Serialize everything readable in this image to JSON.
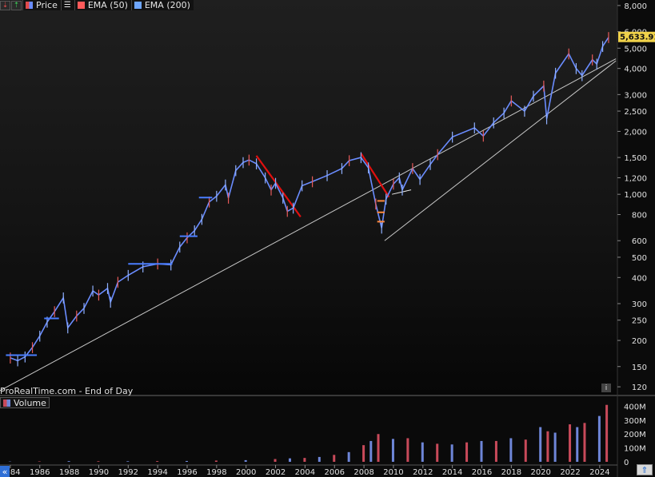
{
  "legend": {
    "items": [
      {
        "label": "Price",
        "color": "#6a8cff"
      },
      {
        "label": "EMA (50)",
        "color": "#ff5a5a"
      },
      {
        "label": "EMA (200)",
        "color": "#6ea6ff"
      }
    ]
  },
  "watermark": "ProRealTime.com - End of Day",
  "volume_label": "Volume",
  "info_icon": "i",
  "chart_data": [
    {
      "type": "line",
      "scale": "log",
      "y_ticks": [
        120,
        150,
        200,
        250,
        300,
        400,
        500,
        600,
        800,
        1000,
        1200,
        1500,
        2000,
        2500,
        3000,
        4000,
        5000,
        6000,
        8000
      ],
      "y_tick_labels": [
        "120",
        "150",
        "200",
        "250",
        "300",
        "400",
        "500",
        "600",
        "800",
        "1,000",
        "1,200",
        "1,500",
        "2,000",
        "2,500",
        "3,000",
        "4,000",
        "5,000",
        "6,000",
        "8,000"
      ],
      "ylim": [
        110,
        8500
      ],
      "xlim": [
        1983.3,
        2025.2
      ],
      "last_price": 5633.91,
      "last_price_label": "5,633.91",
      "series": [
        {
          "x": [
            1984.0,
            1984.5,
            1985.0,
            1985.5,
            1986.0,
            1986.5,
            1987.0,
            1987.6,
            1987.9,
            1988.5,
            1989.0,
            1989.6,
            1990.0,
            1990.6,
            1990.8,
            1991.3,
            1992.0,
            1993.0,
            1994.0,
            1994.9,
            1995.5,
            1996.0,
            1996.5,
            1997.0,
            1997.5,
            1998.0,
            1998.6,
            1998.8,
            1999.3,
            1999.8,
            2000.2,
            2000.7,
            2001.3,
            2001.7,
            2002.0,
            2002.5,
            2002.8,
            2003.2,
            2003.8,
            2004.5,
            2005.5,
            2006.5,
            2007.0,
            2007.8,
            2008.3,
            2008.8,
            2009.2,
            2009.5,
            2010.0,
            2010.4,
            2010.6,
            2011.3,
            2011.8,
            2012.5,
            2013.0,
            2014.0,
            2015.5,
            2016.1,
            2016.8,
            2017.5,
            2018.0,
            2018.9,
            2019.5,
            2020.2,
            2020.4,
            2021.0,
            2021.9,
            2022.4,
            2022.8,
            2023.5,
            2023.8,
            2024.2,
            2024.6
          ],
          "values": [
            165,
            160,
            167,
            185,
            210,
            245,
            275,
            320,
            230,
            262,
            285,
            345,
            330,
            355,
            305,
            380,
            410,
            450,
            465,
            460,
            560,
            620,
            670,
            760,
            920,
            980,
            1110,
            960,
            1300,
            1420,
            1460,
            1400,
            1200,
            1050,
            1130,
            960,
            830,
            860,
            1100,
            1150,
            1230,
            1330,
            1450,
            1500,
            1340,
            900,
            690,
            950,
            1120,
            1200,
            1050,
            1330,
            1180,
            1390,
            1550,
            1880,
            2080,
            1900,
            2200,
            2450,
            2800,
            2500,
            2950,
            3300,
            2300,
            3800,
            4700,
            4000,
            3700,
            4400,
            4200,
            5100,
            5630
          ]
        }
      ],
      "trendlines": [
        {
          "color": "#c8c8c8",
          "points": [
            [
              1983.3,
              115
            ],
            [
              2025.1,
              4450
            ]
          ]
        },
        {
          "color": "#c8c8c8",
          "points": [
            [
              2009.4,
              600
            ],
            [
              2025.1,
              4350
            ]
          ]
        },
        {
          "color": "#e01010",
          "points": [
            [
              2000.7,
              1530
            ],
            [
              2003.7,
              780
            ]
          ]
        },
        {
          "color": "#e01010",
          "points": [
            [
              2007.8,
              1570
            ],
            [
              2009.7,
              970
            ]
          ]
        },
        {
          "color": "#e8e8e8",
          "points": [
            [
              2009.9,
              1000
            ],
            [
              2011.2,
              1050
            ]
          ]
        }
      ],
      "horizontal_levels": [
        {
          "color": "#4a7dff",
          "x": [
            1983.7,
            1985.8
          ],
          "value": 170
        },
        {
          "color": "#4a7dff",
          "x": [
            1986.3,
            1987.3
          ],
          "value": 255
        },
        {
          "color": "#4a7dff",
          "x": [
            1992.0,
            1995.0
          ],
          "value": 465
        },
        {
          "color": "#4a7dff",
          "x": [
            1995.5,
            1996.7
          ],
          "value": 630
        },
        {
          "color": "#4a7dff",
          "x": [
            1996.8,
            1997.7
          ],
          "value": 965
        },
        {
          "color": "#ff8a3d",
          "x": [
            2008.9,
            2009.4
          ],
          "value": 930
        },
        {
          "color": "#ff8a3d",
          "x": [
            2008.9,
            2009.4
          ],
          "value": 820
        },
        {
          "color": "#ff8a3d",
          "x": [
            2008.9,
            2009.4
          ],
          "value": 740
        }
      ]
    },
    {
      "type": "bar",
      "title": "Volume",
      "ylim": [
        0,
        420
      ],
      "y_ticks": [
        0,
        100,
        200,
        300,
        400
      ],
      "y_tick_labels": [
        "0",
        "100M",
        "200M",
        "300M",
        "400M"
      ],
      "x_ticks": [
        1984,
        1986,
        1988,
        1990,
        1992,
        1994,
        1996,
        1998,
        2000,
        2002,
        2004,
        2006,
        2008,
        2010,
        2012,
        2014,
        2016,
        2018,
        2020,
        2022,
        2024
      ],
      "x_tick_labels": [
        "1984",
        "1986",
        "1988",
        "1990",
        "1992",
        "1994",
        "1996",
        "1998",
        "2000",
        "2002",
        "2004",
        "2006",
        "2008",
        "2010",
        "2012",
        "2014",
        "2016",
        "2018",
        "2020",
        "2022",
        "2024"
      ],
      "x": [
        1984,
        1986,
        1988,
        1990,
        1992,
        1994,
        1996,
        1998,
        2000,
        2002,
        2003,
        2004,
        2005,
        2006,
        2007,
        2008,
        2008.5,
        2009,
        2010,
        2011,
        2012,
        2013,
        2014,
        2015,
        2016,
        2017,
        2018,
        2019,
        2020,
        2020.5,
        2021,
        2022,
        2022.5,
        2023,
        2024,
        2024.5
      ],
      "values": [
        2,
        3,
        5,
        4,
        4,
        5,
        6,
        9,
        12,
        20,
        25,
        28,
        35,
        50,
        70,
        120,
        150,
        200,
        165,
        170,
        140,
        130,
        125,
        140,
        150,
        150,
        170,
        160,
        250,
        220,
        210,
        270,
        250,
        280,
        330,
        410
      ],
      "colors": [
        "#6e86d8",
        "#c84a5a"
      ]
    }
  ]
}
